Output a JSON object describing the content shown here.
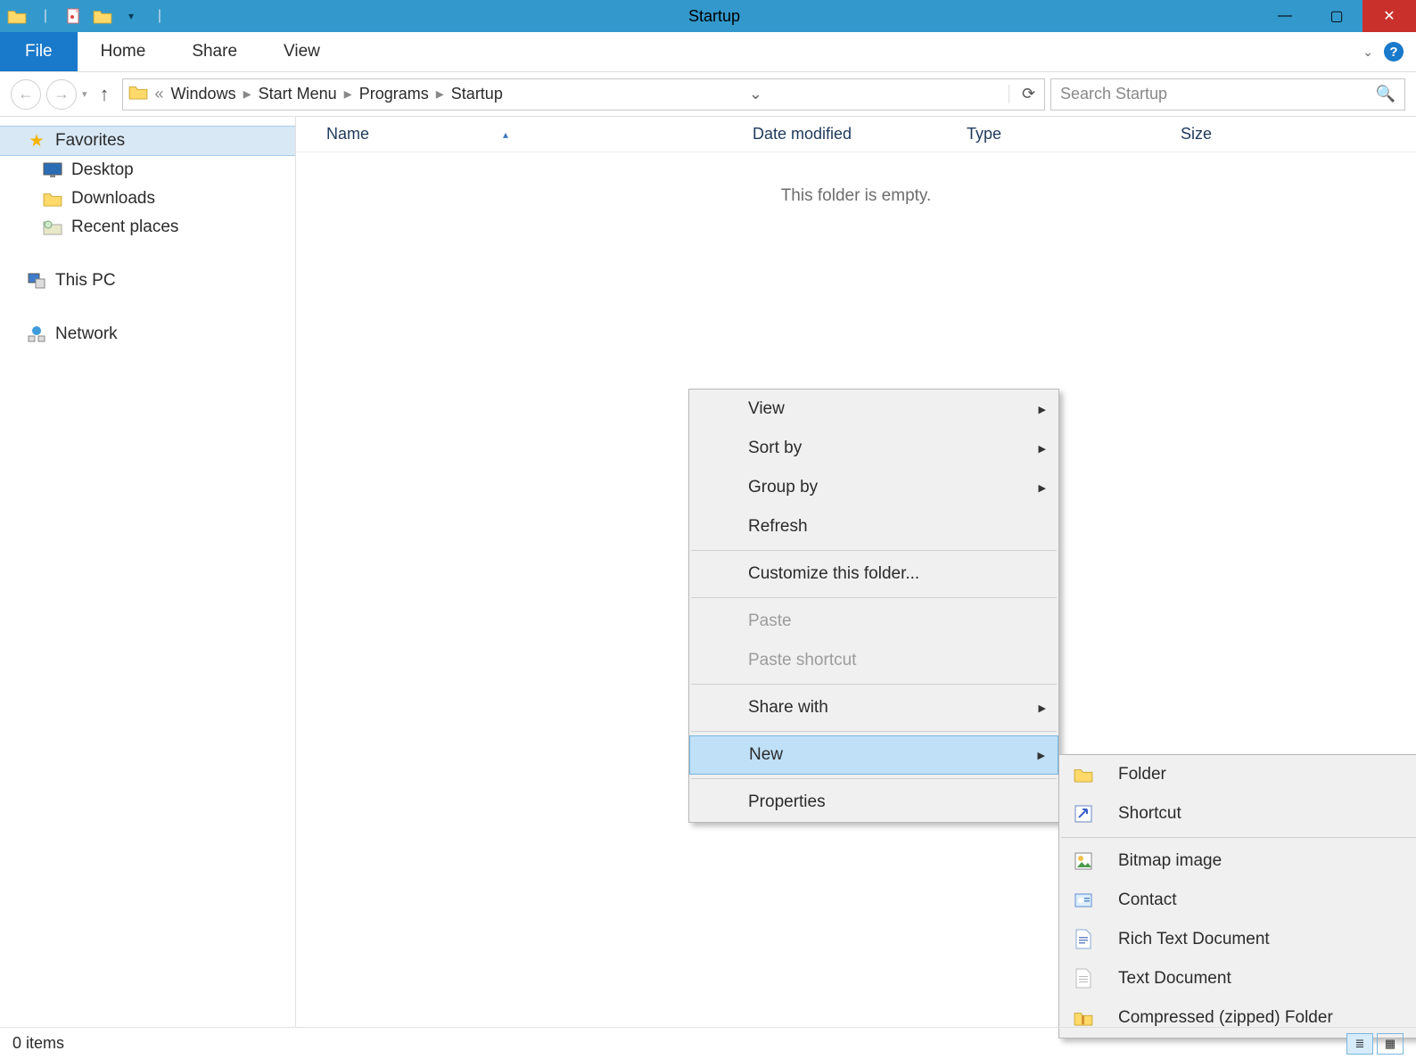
{
  "window": {
    "title": "Startup"
  },
  "ribbon": {
    "file": "File",
    "tabs": [
      "Home",
      "Share",
      "View"
    ]
  },
  "breadcrumb": {
    "items": [
      "Windows",
      "Start Menu",
      "Programs",
      "Startup"
    ]
  },
  "search": {
    "placeholder": "Search Startup"
  },
  "sidebar": {
    "favorites": {
      "header": "Favorites",
      "items": [
        "Desktop",
        "Downloads",
        "Recent places"
      ]
    },
    "this_pc": "This PC",
    "network": "Network"
  },
  "columns": {
    "name": "Name",
    "date": "Date modified",
    "type": "Type",
    "size": "Size"
  },
  "empty_message": "This folder is empty.",
  "context_menu": {
    "view": "View",
    "sort_by": "Sort by",
    "group_by": "Group by",
    "refresh": "Refresh",
    "customize": "Customize this folder...",
    "paste": "Paste",
    "paste_shortcut": "Paste shortcut",
    "share_with": "Share with",
    "new": "New",
    "properties": "Properties"
  },
  "new_submenu": {
    "folder": "Folder",
    "shortcut": "Shortcut",
    "bitmap": "Bitmap image",
    "contact": "Contact",
    "rtf": "Rich Text Document",
    "text": "Text Document",
    "zip": "Compressed (zipped) Folder"
  },
  "statusbar": {
    "items_label": "0 items"
  }
}
